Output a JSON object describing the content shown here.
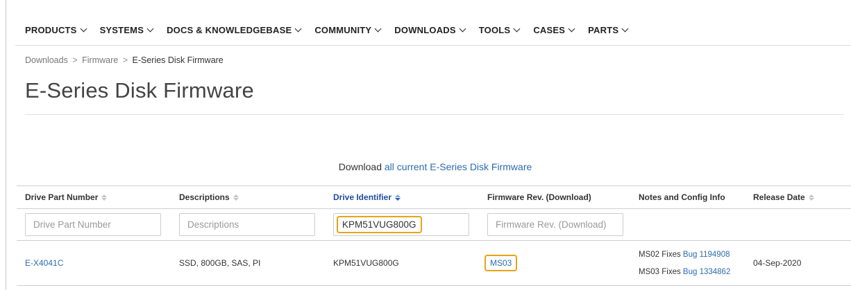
{
  "nav": [
    {
      "label": "PRODUCTS"
    },
    {
      "label": "SYSTEMS"
    },
    {
      "label": "DOCS & KNOWLEDGEBASE"
    },
    {
      "label": "COMMUNITY"
    },
    {
      "label": "DOWNLOADS"
    },
    {
      "label": "TOOLS"
    },
    {
      "label": "CASES"
    },
    {
      "label": "PARTS"
    }
  ],
  "breadcrumb": {
    "items": [
      "Downloads",
      "Firmware"
    ],
    "current": "E-Series Disk Firmware",
    "separator": ">"
  },
  "page_title": "E-Series Disk Firmware",
  "download": {
    "prefix": "Download",
    "link": "all current E-Series Disk Firmware"
  },
  "table": {
    "columns": [
      "Drive Part Number",
      "Descriptions",
      "Drive Identifier",
      "Firmware Rev. (Download)",
      "Notes and Config Info",
      "Release Date"
    ],
    "filters": {
      "part_number_placeholder": "Drive Part Number",
      "descriptions_placeholder": "Descriptions",
      "identifier_value": "KPM51VUG800G",
      "firmware_placeholder": "Firmware Rev. (Download)"
    },
    "rows": [
      {
        "part_number": "E-X4041C",
        "description": "SSD, 800GB, SAS, PI",
        "identifier": "KPM51VUG800G",
        "firmware": "MS03",
        "notes": [
          {
            "prefix": "MS02 Fixes",
            "link": "Bug 1194908"
          },
          {
            "prefix": "MS03 Fixes",
            "link": "Bug 1334862"
          }
        ],
        "release_date": "04-Sep-2020"
      }
    ]
  },
  "colors": {
    "link": "#2b6cb0",
    "highlight": "#e8a317",
    "active_sort": "#1f5fc0"
  }
}
